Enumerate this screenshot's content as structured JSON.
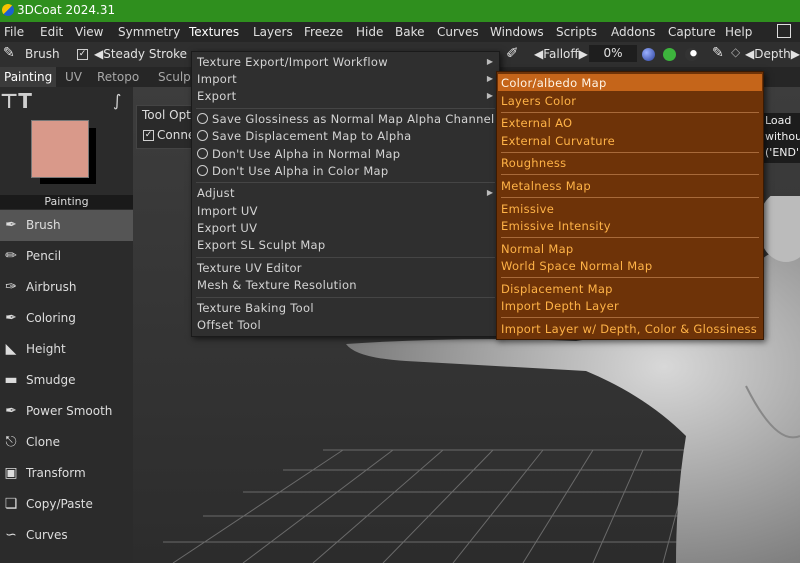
{
  "app": {
    "title": "3DCoat 2024.31"
  },
  "menubar": [
    "File",
    "Edit",
    "View",
    "Symmetry",
    "Textures",
    "Layers",
    "Freeze",
    "Hide",
    "Bake",
    "Curves",
    "Windows",
    "Scripts",
    "Addons",
    "Capture",
    "Help"
  ],
  "toolbar": {
    "brush": "Brush",
    "steady": "Steady Stroke",
    "falloff": "Falloff",
    "percent": "0%",
    "depth": "Depth"
  },
  "tabs": [
    "Painting",
    "UV",
    "Retopo",
    "Sculpt"
  ],
  "left_panel": {
    "section": "Painting",
    "tools": [
      "Brush",
      "Pencil",
      "Airbrush",
      "Coloring",
      "Height",
      "Smudge",
      "Power Smooth",
      "Clone",
      "Transform",
      "Copy/Paste",
      "Curves"
    ]
  },
  "tool_options": {
    "title": "Tool Opt",
    "connect": "Conne"
  },
  "right_info": [
    "Load",
    "withou",
    "('END'"
  ],
  "textures_menu": {
    "items": [
      "Texture Export/Import Workflow",
      "Import",
      "Export",
      "Save Glossiness as Normal Map Alpha Channel",
      "Save Displacement Map to Alpha",
      "Don't Use Alpha in Normal Map",
      "Don't Use Alpha in Color Map",
      "Adjust",
      "Import UV",
      "Export UV",
      "Export SL Sculpt Map",
      "Texture UV Editor",
      "Mesh & Texture Resolution",
      "Texture Baking Tool",
      "Offset Tool"
    ]
  },
  "import_submenu": {
    "items": [
      "Color/albedo Map",
      "Layers Color",
      "External AO",
      "External Curvature",
      "Roughness",
      "Metalness Map",
      "Emissive",
      "Emissive Intensity",
      "Normal Map",
      "World Space Normal Map",
      "Displacement Map",
      "Import Depth Layer",
      "Import Layer w/ Depth, Color & Glossiness"
    ]
  },
  "colors": {
    "title_bar": "#2f8f1e",
    "submenu_bg": "#6e3308",
    "submenu_highlight": "#c5651a",
    "submenu_text": "#ffb347",
    "current_color": "#d9998a"
  }
}
